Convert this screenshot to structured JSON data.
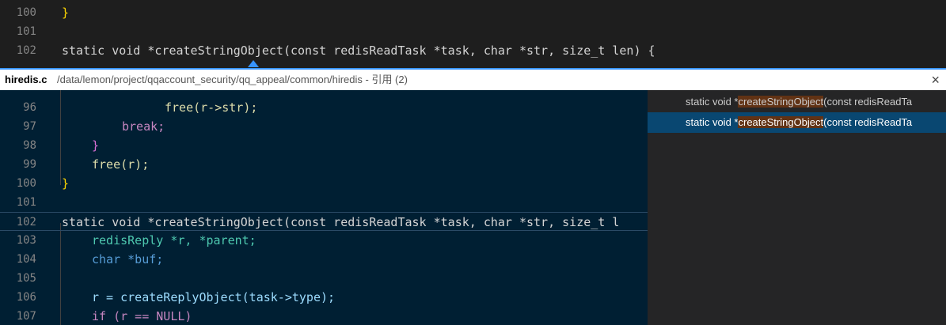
{
  "top_lines": [
    {
      "n": "100",
      "code": "}"
    },
    {
      "n": "101",
      "code": ""
    },
    {
      "n": "102",
      "code": "static void *createStringObject(const redisReadTask *task, char *str, size_t len) {"
    }
  ],
  "peek": {
    "file": "hiredis.c",
    "path": "/data/lemon/project/qqaccount_security/qq_appeal/common/hiredis - 引用 (2)",
    "close": "×"
  },
  "peek_lines": [
    {
      "n": "96",
      "code": "free(r->str);"
    },
    {
      "n": "97",
      "code": "break;"
    },
    {
      "n": "98",
      "code": "}"
    },
    {
      "n": "99",
      "code": "free(r);"
    },
    {
      "n": "100",
      "code": "}"
    },
    {
      "n": "101",
      "code": ""
    },
    {
      "n": "102",
      "code": "static void *createStringObject(const redisReadTask *task, char *str, size_t l"
    },
    {
      "n": "103",
      "code": "redisReply *r, *parent;"
    },
    {
      "n": "104",
      "code": "char *buf;"
    },
    {
      "n": "105",
      "code": ""
    },
    {
      "n": "106",
      "code": "r = createReplyObject(task->type);"
    },
    {
      "n": "107",
      "code": "if (r == NULL)"
    }
  ],
  "references": [
    {
      "pre": "static void *",
      "match": "createStringObject",
      "post": "(const redisReadTa"
    },
    {
      "pre": "static void *",
      "match": "createStringObject",
      "post": "(const redisReadTa"
    }
  ],
  "colors": {
    "accent": "#3794ff",
    "peek_bg": "#001f33",
    "match": "#8b4a00",
    "selected_ref": "#094771"
  }
}
